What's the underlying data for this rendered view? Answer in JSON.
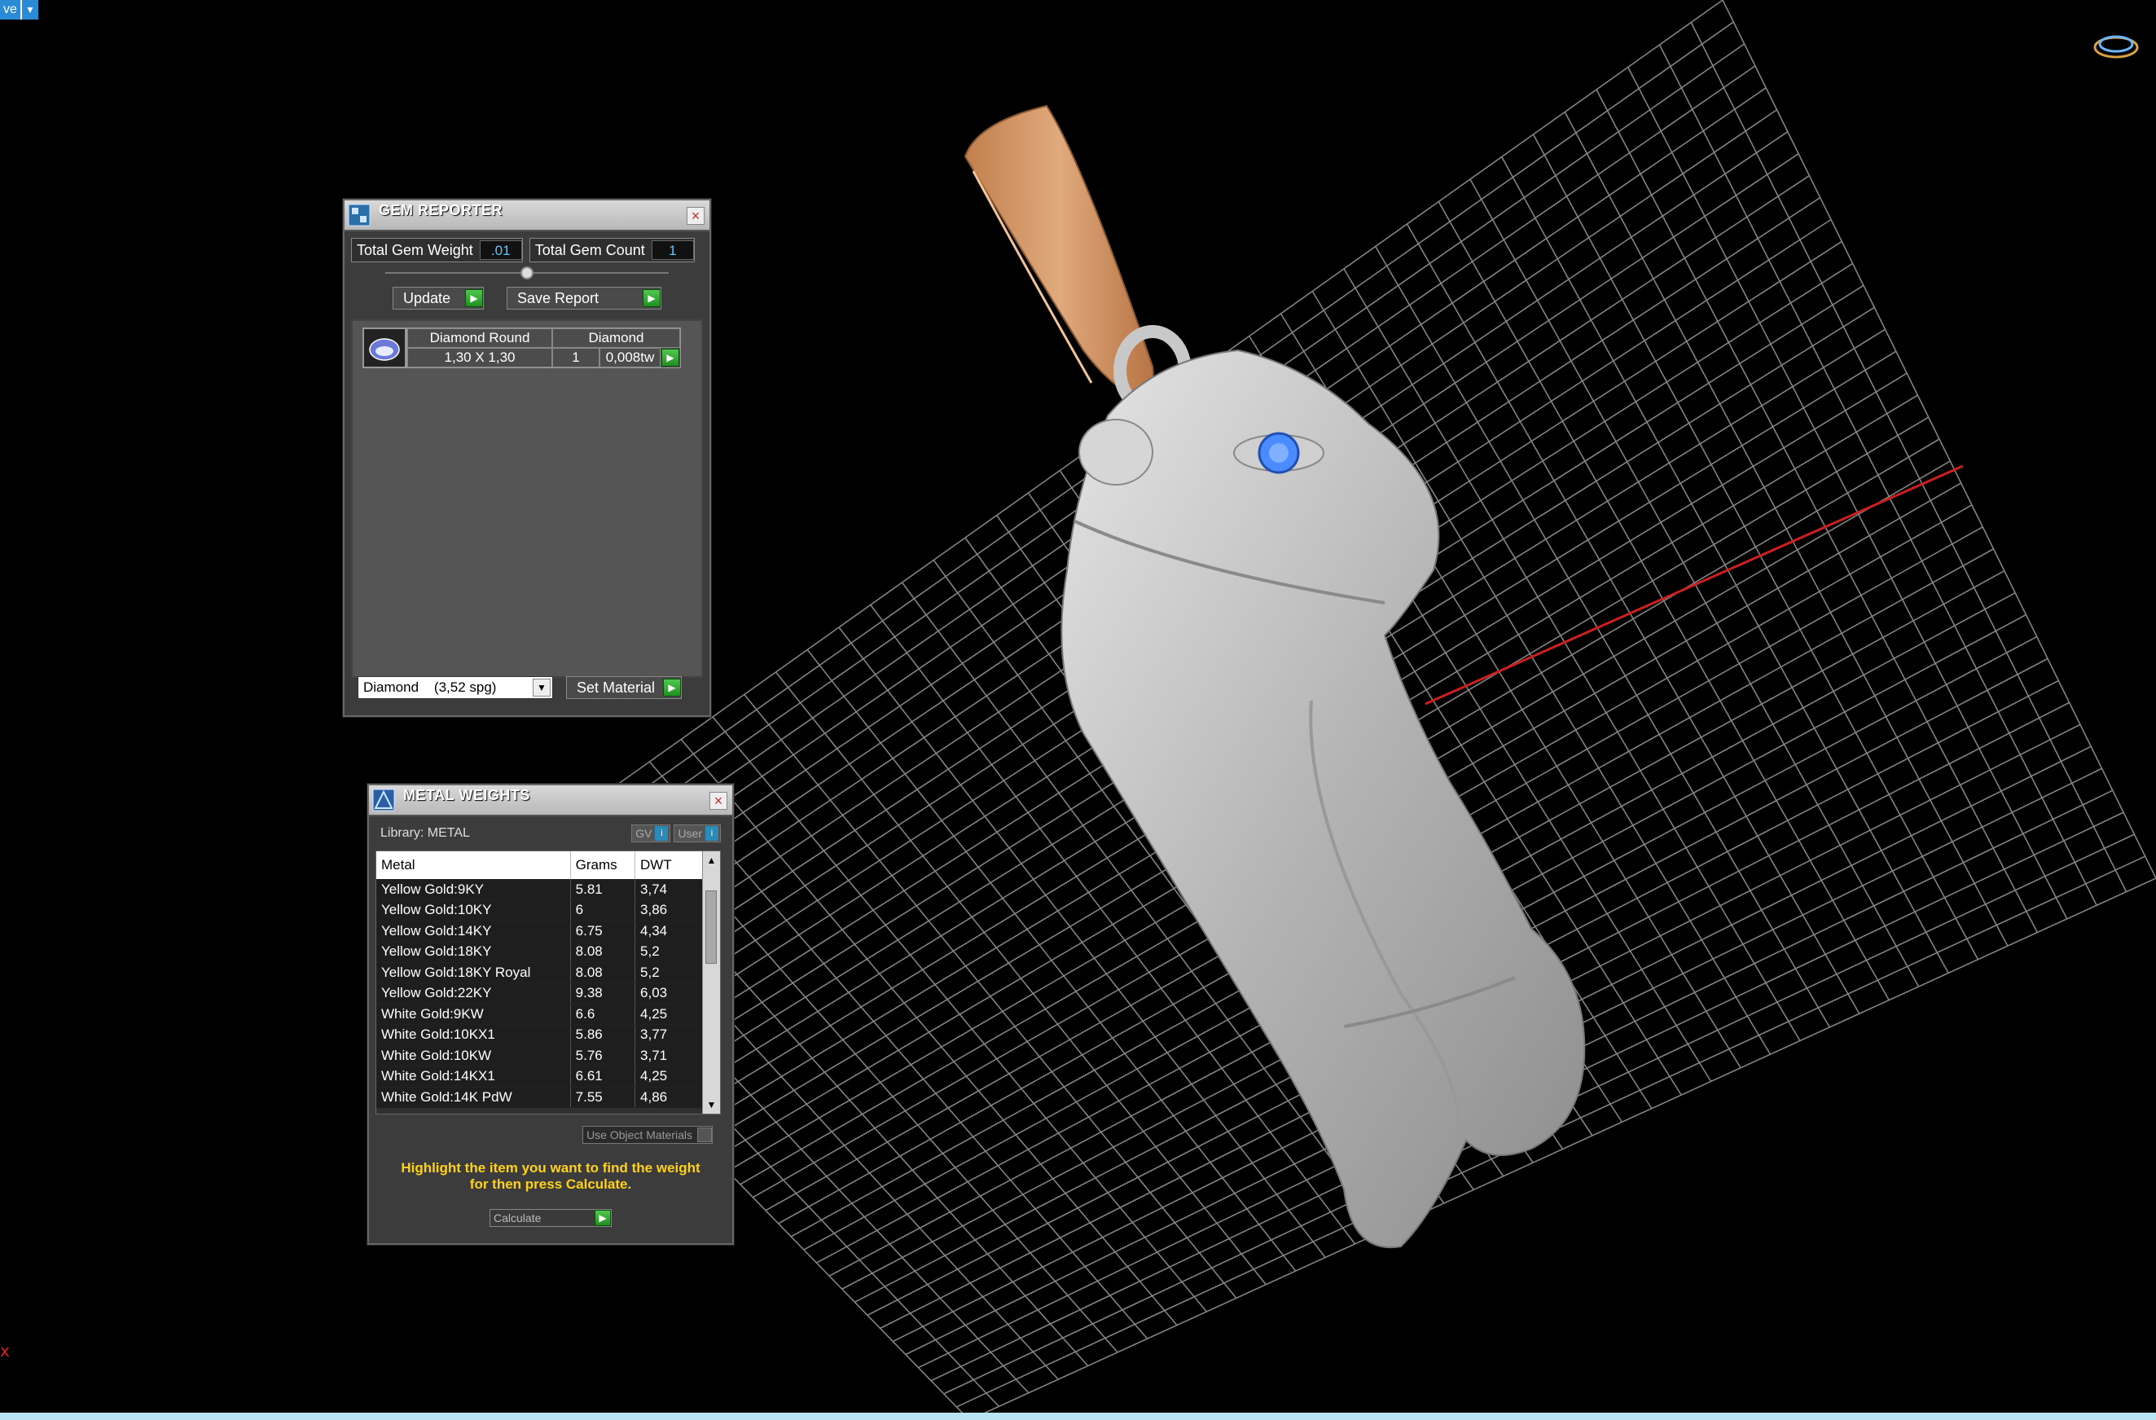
{
  "toolbar_combo": {
    "text": "ve",
    "arrow_icon": "chevron-down-icon"
  },
  "colors": {
    "background": "#000000",
    "grid": "#9a9a9a",
    "x_axis": "#cc1f1f",
    "bail_metal": "#d49a6a",
    "model_metal": "#b8b8b8",
    "gem": "#4a8cff",
    "accent_green": "#2faa2f",
    "hint_text": "#ffd21a"
  },
  "gem_reporter": {
    "title": "GEM REPORTER",
    "total_gem_weight_label": "Total Gem Weight",
    "total_gem_weight_value": ".01",
    "total_gem_count_label": "Total Gem Count",
    "total_gem_count_value": "1",
    "update_label": "Update",
    "save_report_label": "Save Report",
    "gem": {
      "shape": "Diamond Round",
      "size": "1,30 X 1,30",
      "material": "Diamond",
      "count": "1",
      "weight": "0,008tw"
    },
    "material_select": "Diamond    (3,52 spg)",
    "set_material_label": "Set Material"
  },
  "metal_weights": {
    "title": "METAL WEIGHTS",
    "library_label": "Library: METAL",
    "gv_label": "GV",
    "user_label": "User",
    "columns": [
      "Metal",
      "Grams",
      "DWT"
    ],
    "rows": [
      [
        "Yellow Gold:9KY",
        "5.81",
        "3,74"
      ],
      [
        "Yellow Gold:10KY",
        "6",
        "3,86"
      ],
      [
        "Yellow Gold:14KY",
        "6.75",
        "4,34"
      ],
      [
        "Yellow Gold:18KY",
        "8.08",
        "5,2"
      ],
      [
        "Yellow Gold:18KY Royal",
        "8.08",
        "5,2"
      ],
      [
        "Yellow Gold:22KY",
        "9.38",
        "6,03"
      ],
      [
        "White Gold:9KW",
        "6.6",
        "4,25"
      ],
      [
        "White Gold:10KX1",
        "5.86",
        "3,77"
      ],
      [
        "White Gold:10KW",
        "5.76",
        "3,71"
      ],
      [
        "White Gold:14KX1",
        "6.61",
        "4,25"
      ],
      [
        "White Gold:14K PdW",
        "7.55",
        "4,86"
      ]
    ],
    "use_object_materials_label": "Use Object Materials",
    "hint_line1": "Highlight the item you want to find the weight",
    "hint_line2": "for then press Calculate.",
    "calculate_label": "Calculate"
  },
  "viewport": {
    "axis_marker": "x",
    "orientation_icon": "ring-orientation-icon"
  }
}
